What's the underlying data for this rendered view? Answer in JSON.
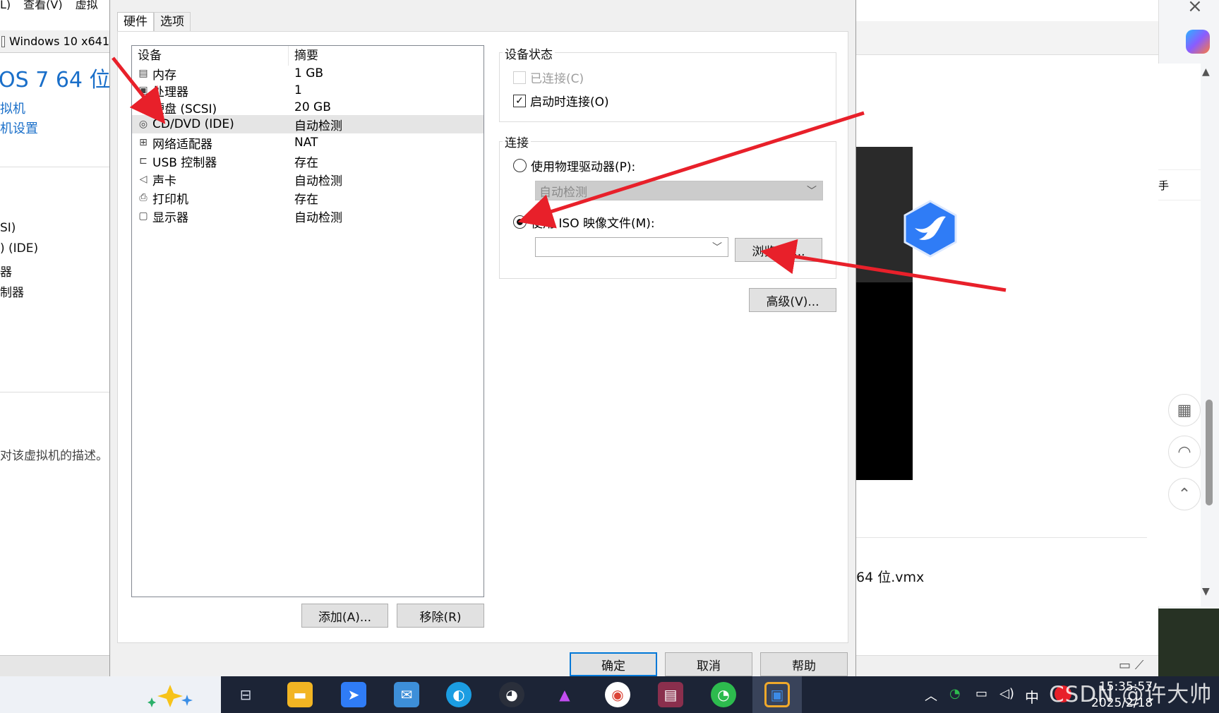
{
  "background_window": {
    "menu_items": [
      "L)",
      "查看(V)",
      "虚拟"
    ],
    "tab_label": "Windows 10 x641",
    "vm_title": "OS 7 64 位",
    "links": [
      "拟机",
      "机设置"
    ],
    "devices": [
      "SI)",
      ") (IDE)",
      "器",
      "制器"
    ],
    "description": "对该虚拟机的描述。",
    "vmx_path": "64 位.vmx"
  },
  "dialog": {
    "tabs": [
      "硬件",
      "选项"
    ],
    "device_list": {
      "headers": [
        "设备",
        "摘要"
      ],
      "rows": [
        {
          "device": "内存",
          "summary": "1 GB",
          "icon": "memory-icon"
        },
        {
          "device": "处理器",
          "summary": "1",
          "icon": "cpu-icon"
        },
        {
          "device": "硬盘 (SCSI)",
          "summary": "20 GB",
          "icon": "harddisk-icon"
        },
        {
          "device": "CD/DVD (IDE)",
          "summary": "自动检测",
          "icon": "cdrom-icon"
        },
        {
          "device": "网络适配器",
          "summary": "NAT",
          "icon": "network-icon"
        },
        {
          "device": "USB 控制器",
          "summary": "存在",
          "icon": "usb-icon"
        },
        {
          "device": "声卡",
          "summary": "自动检测",
          "icon": "speaker-icon"
        },
        {
          "device": "打印机",
          "summary": "存在",
          "icon": "printer-icon"
        },
        {
          "device": "显示器",
          "summary": "自动检测",
          "icon": "monitor-icon"
        }
      ],
      "selected_index": 3
    },
    "add_button": "添加(A)...",
    "remove_button": "移除(R)",
    "device_status": {
      "title": "设备状态",
      "connected_label": "已连接(C)",
      "connected": false,
      "connect_at_power_on_label": "启动时连接(O)",
      "connect_at_power_on": true
    },
    "connection": {
      "title": "连接",
      "physical_drive_label": "使用物理驱动器(P):",
      "physical_drive_value": "自动检测",
      "iso_label": "使用 ISO 映像文件(M):",
      "iso_value": "",
      "selected": "iso",
      "browse_button": "浏览(B)..."
    },
    "advanced_button": "高级(V)...",
    "ok_button": "确定",
    "cancel_button": "取消",
    "help_button": "帮助"
  },
  "sidebar": {
    "assistant_text": "手"
  },
  "taskbar": {
    "ime_label": "中",
    "time": "15:35:57",
    "date": "2025/2/18"
  },
  "watermark": "CSDN @许大帅",
  "colors": {
    "arrow": "#e8202a",
    "accent": "#0078d7",
    "link": "#1a6fc9",
    "taskbar": "#1c2436"
  }
}
